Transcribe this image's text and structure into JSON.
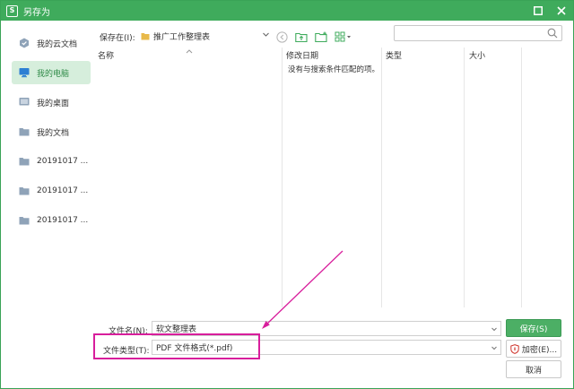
{
  "titlebar": {
    "app_glyph": "S",
    "title": "另存为"
  },
  "sidebar": {
    "items": [
      {
        "label": "我的云文档",
        "icon": "cloud-doc-icon"
      },
      {
        "label": "我的电脑",
        "icon": "computer-icon",
        "active": true
      },
      {
        "label": "我的桌面",
        "icon": "desktop-icon"
      },
      {
        "label": "我的文档",
        "icon": "folder-icon"
      },
      {
        "label": "20191017 ...",
        "icon": "folder-icon"
      },
      {
        "label": "20191017 ...",
        "icon": "folder-icon"
      },
      {
        "label": "20191017 ...",
        "icon": "folder-icon"
      }
    ]
  },
  "pathbar": {
    "label": "保存在(I):",
    "value": "推广工作整理表"
  },
  "search": {
    "placeholder": ""
  },
  "file_list": {
    "columns": [
      "名称",
      "修改日期",
      "类型",
      "大小"
    ],
    "empty_message": "没有与搜索条件匹配的项。"
  },
  "form": {
    "filename_label": "文件名(N):",
    "filename_value": "软文整理表",
    "filetype_label": "文件类型(T):",
    "filetype_value": "PDF 文件格式(*.pdf)"
  },
  "buttons": {
    "save": "保存(S)",
    "encrypt": "加密(E)...",
    "cancel": "取消"
  },
  "colors": {
    "accent": "#3fab5c",
    "highlight": "#d81e9c"
  }
}
